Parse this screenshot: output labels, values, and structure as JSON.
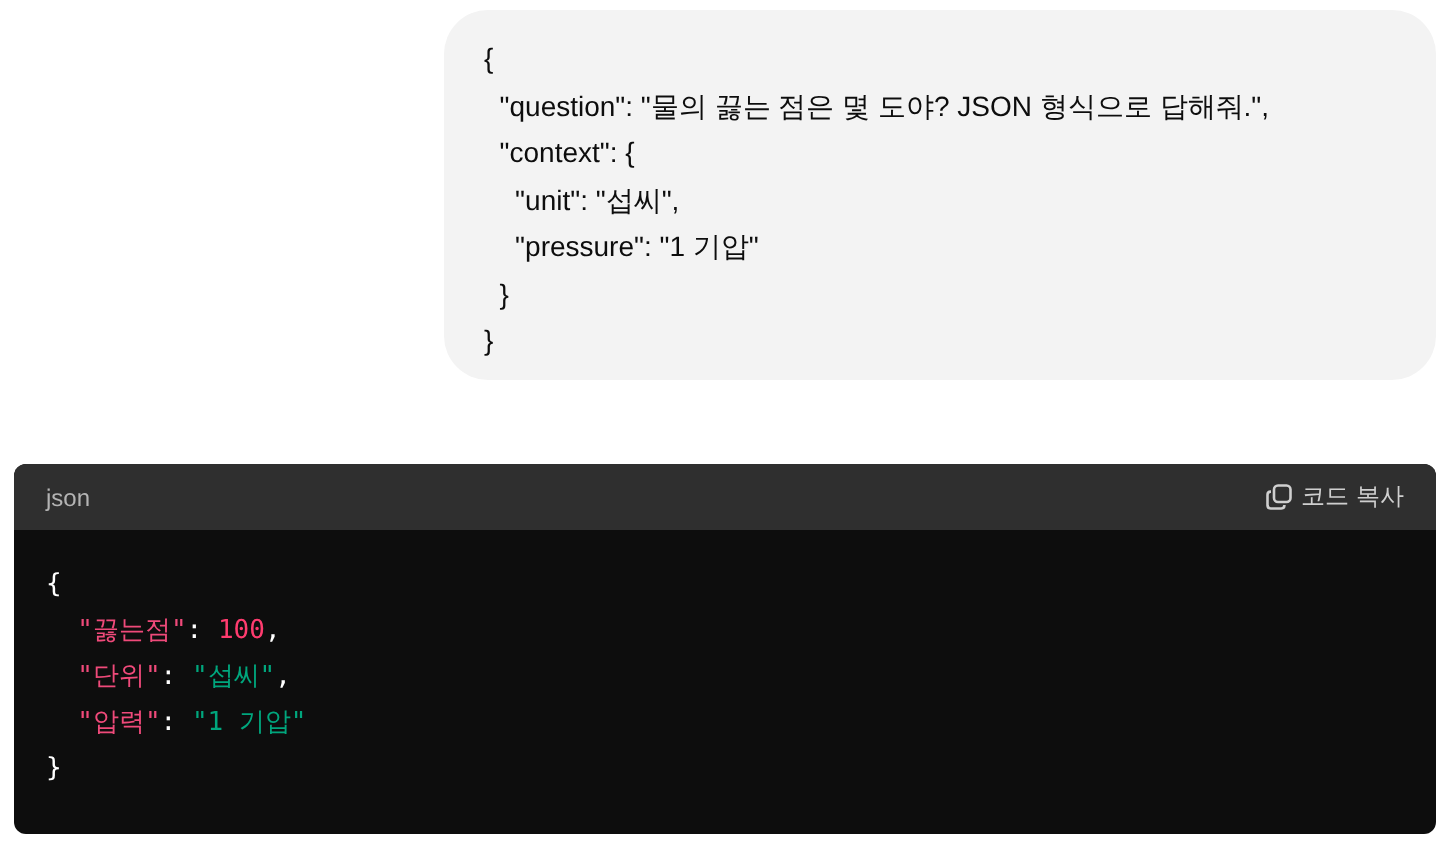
{
  "user_message": {
    "lines": [
      "{",
      "  \"question\": \"물의 끓는 점은 몇 도야? JSON 형식으로 답해줘.\",",
      "  \"context\": {",
      "    \"unit\": \"섭씨\",",
      "    \"pressure\": \"1 기압\"",
      "  }",
      "}"
    ]
  },
  "code_block": {
    "language": "json",
    "copy_label": "코드 복사",
    "lines": [
      {
        "nested": false,
        "tokens": [
          {
            "kind": "punct",
            "text": "{"
          }
        ]
      },
      {
        "nested": true,
        "tokens": [
          {
            "kind": "key",
            "text": "\"끓는점\""
          },
          {
            "kind": "punct",
            "text": ": "
          },
          {
            "kind": "number",
            "text": "100"
          },
          {
            "kind": "punct",
            "text": ","
          }
        ]
      },
      {
        "nested": true,
        "tokens": [
          {
            "kind": "key",
            "text": "\"단위\""
          },
          {
            "kind": "punct",
            "text": ": "
          },
          {
            "kind": "string",
            "text": "\"섭씨\""
          },
          {
            "kind": "punct",
            "text": ","
          }
        ]
      },
      {
        "nested": true,
        "tokens": [
          {
            "kind": "key",
            "text": "\"압력\""
          },
          {
            "kind": "punct",
            "text": ": "
          },
          {
            "kind": "string",
            "text": "\"1 기압\""
          }
        ]
      },
      {
        "nested": false,
        "tokens": [
          {
            "kind": "punct",
            "text": "}"
          }
        ]
      }
    ]
  }
}
